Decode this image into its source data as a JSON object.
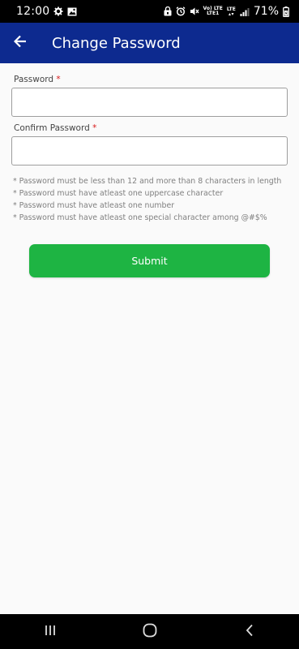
{
  "status_bar": {
    "time": "12:00",
    "network_label_top": "Vo) LTE",
    "network_label_bottom": "LTE1",
    "network_label_2_top": "LTE",
    "battery": "71%",
    "icons": [
      "gear-icon",
      "image-icon",
      "lock-notification-icon",
      "alarm-icon",
      "mute-icon",
      "signal-icon",
      "battery-icon"
    ]
  },
  "app_bar": {
    "title": "Change Password",
    "back_icon": "arrow-back-icon",
    "color": "#0d2a8f"
  },
  "form": {
    "password_label": "Password",
    "confirm_label": "Confirm Password",
    "required_mark": "*",
    "password_value": "",
    "confirm_value": ""
  },
  "rules": [
    "* Password must be less than 12 and more than 8 characters in length",
    "* Password must have atleast one uppercase character",
    "* Password must have atleast one number",
    "* Password must have atleast one special character among @#$%"
  ],
  "submit": {
    "label": "Submit",
    "color": "#1eb443"
  },
  "nav_bar": {
    "icons": [
      "recent-apps-icon",
      "home-icon",
      "back-icon"
    ]
  }
}
